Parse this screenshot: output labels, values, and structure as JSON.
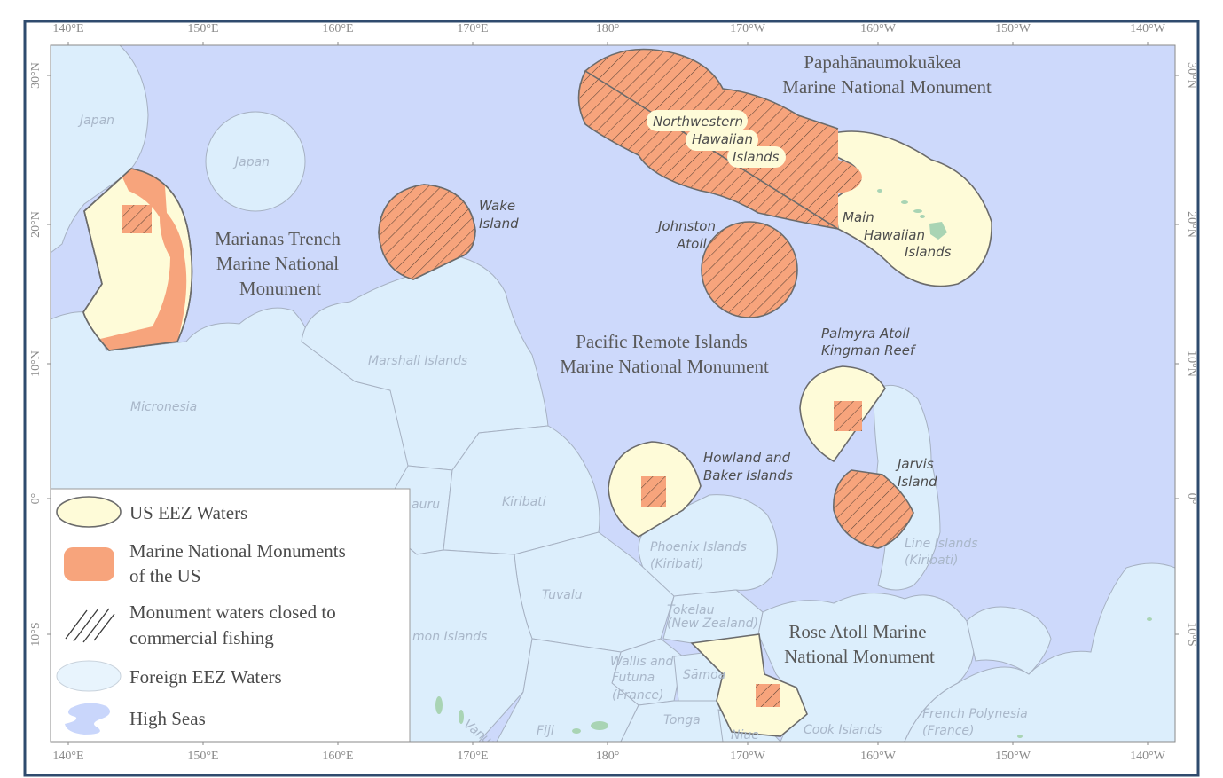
{
  "ticks": {
    "lon": [
      "140°E",
      "150°E",
      "160°E",
      "170°E",
      "180°",
      "170°W",
      "160°W",
      "150°W",
      "140°W"
    ],
    "lat": [
      "30°N",
      "20°N",
      "10°N",
      "0°",
      "10°S"
    ]
  },
  "foreign_labels": {
    "japan_1": "Japan",
    "japan_2": "Japan",
    "marshall": "Marshall Islands",
    "micronesia": "Micronesia",
    "nauru": "auru",
    "kiribati": "Kiribati",
    "phoenix_1": "Phoenix Islands",
    "phoenix_2": "(Kiribati)",
    "line_1": "Line Islands",
    "line_2": "(Kiribati)",
    "tuvalu": "Tuvalu",
    "tokelau_1": "Tokelau",
    "tokelau_2": "(New Zealand)",
    "solomon": "mon Islands",
    "wallis_1": "Wallis and",
    "wallis_2": "Futuna",
    "wallis_3": "(France)",
    "samoa": "Sāmoa",
    "tonga": "Tonga",
    "fiji": "Fiji",
    "vanuatu": "Vanua",
    "niue": "Niue",
    "cook": "Cook Islands",
    "fp_1": "French Polynesia",
    "fp_2": "(France)"
  },
  "us_labels": {
    "nwhi_1": "Northwestern",
    "nwhi_2": "Hawaiian",
    "nwhi_3": "Islands",
    "main_1": "Main",
    "main_2": "Hawaiian",
    "main_3": "Islands",
    "wake_1": "Wake",
    "wake_2": "Island",
    "johnston_1": "Johnston",
    "johnston_2": "Atoll",
    "palmyra_1": "Palmyra Atoll",
    "palmyra_2": "Kingman Reef",
    "howland_1": "Howland and",
    "howland_2": "Baker Islands",
    "jarvis_1": "Jarvis",
    "jarvis_2": "Island"
  },
  "monument_labels": {
    "papa_1": "Papahānaumokuākea",
    "papa_2": "Marine National Monument",
    "marianas_1": "Marianas Trench",
    "marianas_2": "Marine National",
    "marianas_3": "Monument",
    "pri_1": "Pacific Remote Islands",
    "pri_2": "Marine National Monument",
    "rose_1": "Rose Atoll Marine",
    "rose_2": "National Monument"
  },
  "legend": {
    "us_eez": "US EEZ Waters",
    "mnm_1": "Marine National Monuments",
    "mnm_2": "of the US",
    "closed_1": "Monument waters closed to",
    "closed_2": "commercial fishing",
    "foreign": "Foreign EEZ Waters",
    "high_seas": "High Seas"
  },
  "colors": {
    "high_seas": "#cdd9fb",
    "foreign_eez": "#dceefc",
    "us_eez": "#fefbd8",
    "monument": "#f7a47c",
    "frame": "#2f4b6e"
  }
}
